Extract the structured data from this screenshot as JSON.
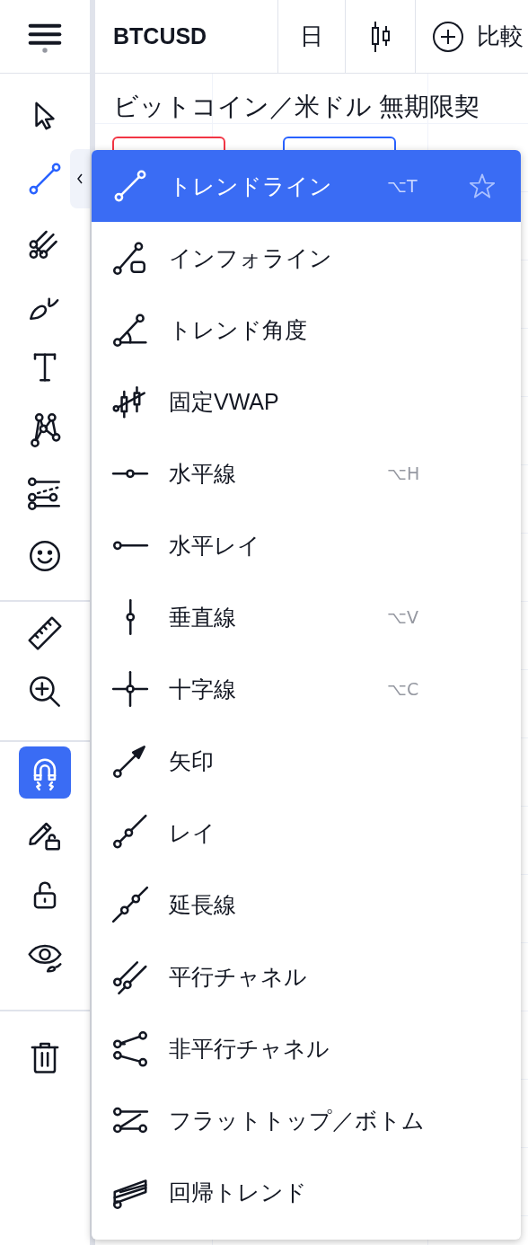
{
  "top_bar": {
    "symbol": "BTCUSD",
    "interval": "日",
    "compare": "比較"
  },
  "chart": {
    "title": "ビットコイン／米ドル 無期限契"
  },
  "toolbar": {
    "groups": [
      {
        "tools": [
          {
            "kind": "cursor",
            "selected": false
          },
          {
            "kind": "trend",
            "selected": true
          },
          {
            "kind": "pitchfork",
            "selected": false
          },
          {
            "kind": "brush",
            "selected": false
          },
          {
            "kind": "text",
            "selected": false
          },
          {
            "kind": "pattern",
            "selected": false
          },
          {
            "kind": "fib",
            "selected": false
          },
          {
            "kind": "smiley",
            "selected": false
          }
        ]
      },
      {
        "tools": [
          {
            "kind": "ruler",
            "selected": false
          },
          {
            "kind": "zoom",
            "selected": false
          }
        ]
      },
      {
        "tools": [
          {
            "kind": "magnet",
            "selected": true
          },
          {
            "kind": "pencil-lock",
            "selected": false
          },
          {
            "kind": "lock",
            "selected": false
          },
          {
            "kind": "eye",
            "selected": false
          }
        ]
      },
      {
        "tools": [
          {
            "kind": "trash",
            "selected": false
          }
        ]
      }
    ]
  },
  "menu": {
    "items": [
      {
        "kind": "trend",
        "label": "トレンドライン",
        "shortcut": "⌥T",
        "selected": true
      },
      {
        "kind": "info",
        "label": "インフォライン",
        "selected": false
      },
      {
        "kind": "angle",
        "label": "トレンド角度",
        "selected": false
      },
      {
        "kind": "vwap",
        "label": "固定VWAP",
        "selected": false
      },
      {
        "kind": "hline",
        "label": "水平線",
        "shortcut": "⌥H",
        "selected": false
      },
      {
        "kind": "hray",
        "label": "水平レイ",
        "selected": false
      },
      {
        "kind": "vline",
        "label": "垂直線",
        "shortcut": "⌥V",
        "selected": false
      },
      {
        "kind": "cross",
        "label": "十字線",
        "shortcut": "⌥C",
        "selected": false
      },
      {
        "kind": "arrow",
        "label": "矢印",
        "selected": false
      },
      {
        "kind": "ray",
        "label": "レイ",
        "selected": false
      },
      {
        "kind": "extended",
        "label": "延長線",
        "selected": false
      },
      {
        "kind": "parallel",
        "label": "平行チャネル",
        "selected": false
      },
      {
        "kind": "nonparallel",
        "label": "非平行チャネル",
        "selected": false
      },
      {
        "kind": "flattop",
        "label": "フラットトップ／ボトム",
        "selected": false
      },
      {
        "kind": "regression",
        "label": "回帰トレンド",
        "selected": false
      }
    ]
  }
}
